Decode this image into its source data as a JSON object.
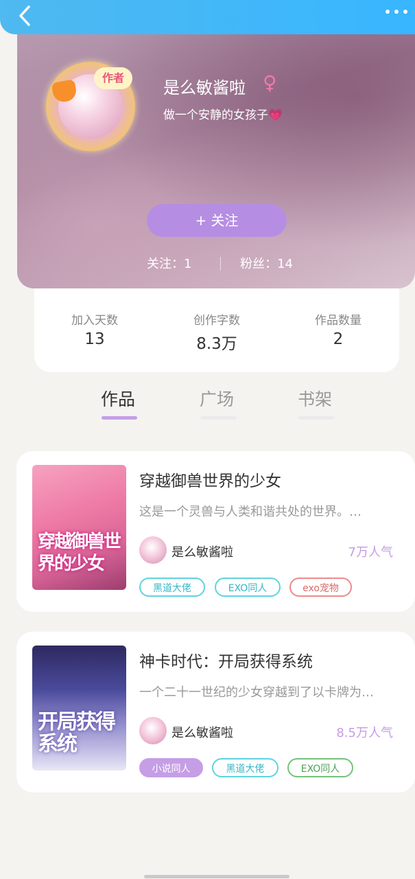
{
  "header": {
    "back_icon": "chevron-left-icon",
    "more_icon": "more-dots-icon",
    "accent": "#38b6ff"
  },
  "profile": {
    "name": "是么敏酱啦",
    "gender_symbol": "♀",
    "badge": "作者",
    "signature": "做一个安静的女孩子💗",
    "follow_button": "+  关注",
    "following": "关注：1",
    "fans": "粉丝：14"
  },
  "stats": [
    {
      "label": "加入天数",
      "value": "13"
    },
    {
      "label": "创作字数",
      "value": "8.3万"
    },
    {
      "label": "作品数量",
      "value": "2"
    }
  ],
  "tabs": [
    {
      "label": "作品",
      "active": true
    },
    {
      "label": "广场",
      "active": false
    },
    {
      "label": "书架",
      "active": false
    }
  ],
  "books": [
    {
      "title": "穿越御兽世界的少女",
      "cover_text": "穿越御兽世界的少女",
      "desc": "这是一个灵兽与人类和谐共处的世界。…",
      "author": "是么敏酱啦",
      "popularity": "7万人气",
      "tags": [
        "黑道大佬",
        "EXO同人",
        "exo宠物"
      ]
    },
    {
      "title": "神卡时代：开局获得系统",
      "cover_text": "开局获得系统",
      "desc": "一个二十一世纪的少女穿越到了以卡牌为…",
      "author": "是么敏酱啦",
      "popularity": "8.5万人气",
      "tags": [
        "小说同人",
        "黑道大佬",
        "EXO同人"
      ]
    }
  ]
}
